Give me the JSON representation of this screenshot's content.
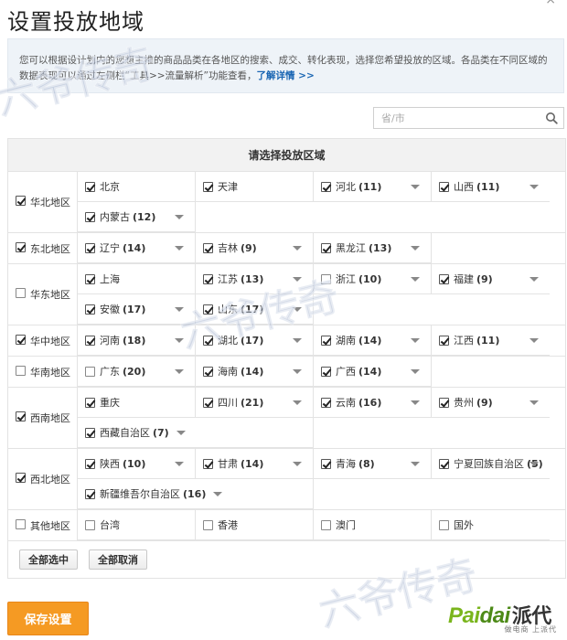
{
  "dialog": {
    "title": "设置投放地域",
    "close_label": "×"
  },
  "notice": {
    "text": "您可以根据设计划内的您想主推的商品品类在各地区的搜索、成交、转化表现，选择您希望投放的区域。各品类在不同区域的数据表现可以通过左侧栏“工具>>流量解析”功能查看，",
    "link": "了解详情 >>"
  },
  "search": {
    "placeholder": "省/市",
    "value": "",
    "icon": "search-icon"
  },
  "table": {
    "header": "请选择投放区域",
    "regions": [
      {
        "name": "华北地区",
        "checked": true,
        "provinces": [
          {
            "name": "北京",
            "count": "",
            "checked": true,
            "arrow": false
          },
          {
            "name": "天津",
            "count": "",
            "checked": true,
            "arrow": false
          },
          {
            "name": "河北",
            "count": "(11)",
            "checked": true,
            "arrow": true
          },
          {
            "name": "山西",
            "count": "(11)",
            "checked": true,
            "arrow": true
          },
          {
            "name": "内蒙古",
            "count": "(12)",
            "checked": true,
            "arrow": true
          }
        ]
      },
      {
        "name": "东北地区",
        "checked": true,
        "provinces": [
          {
            "name": "辽宁",
            "count": "(14)",
            "checked": true,
            "arrow": true
          },
          {
            "name": "吉林",
            "count": "(9)",
            "checked": true,
            "arrow": true
          },
          {
            "name": "黑龙江",
            "count": "(13)",
            "checked": true,
            "arrow": true
          }
        ]
      },
      {
        "name": "华东地区",
        "checked": false,
        "provinces": [
          {
            "name": "上海",
            "count": "",
            "checked": true,
            "arrow": false
          },
          {
            "name": "江苏",
            "count": "(13)",
            "checked": true,
            "arrow": true
          },
          {
            "name": "浙江",
            "count": "(10)",
            "checked": false,
            "arrow": true
          },
          {
            "name": "福建",
            "count": "(9)",
            "checked": true,
            "arrow": true
          },
          {
            "name": "安徽",
            "count": "(17)",
            "checked": true,
            "arrow": true
          },
          {
            "name": "山东",
            "count": "(17)",
            "checked": true,
            "arrow": true
          }
        ]
      },
      {
        "name": "华中地区",
        "checked": true,
        "provinces": [
          {
            "name": "河南",
            "count": "(18)",
            "checked": true,
            "arrow": true
          },
          {
            "name": "湖北",
            "count": "(17)",
            "checked": true,
            "arrow": true
          },
          {
            "name": "湖南",
            "count": "(14)",
            "checked": true,
            "arrow": true
          },
          {
            "name": "江西",
            "count": "(11)",
            "checked": true,
            "arrow": true
          }
        ]
      },
      {
        "name": "华南地区",
        "checked": false,
        "provinces": [
          {
            "name": "广东",
            "count": "(20)",
            "checked": false,
            "arrow": true
          },
          {
            "name": "海南",
            "count": "(14)",
            "checked": true,
            "arrow": true
          },
          {
            "name": "广西",
            "count": "(14)",
            "checked": true,
            "arrow": true
          }
        ]
      },
      {
        "name": "西南地区",
        "checked": true,
        "provinces": [
          {
            "name": "重庆",
            "count": "",
            "checked": true,
            "arrow": false
          },
          {
            "name": "四川",
            "count": "(21)",
            "checked": true,
            "arrow": true
          },
          {
            "name": "云南",
            "count": "(16)",
            "checked": true,
            "arrow": true
          },
          {
            "name": "贵州",
            "count": "(9)",
            "checked": true,
            "arrow": true
          },
          {
            "name": "西藏自治区",
            "count": "(7)",
            "checked": true,
            "arrow": true
          }
        ]
      },
      {
        "name": "西北地区",
        "checked": true,
        "provinces": [
          {
            "name": "陕西",
            "count": "(10)",
            "checked": true,
            "arrow": true
          },
          {
            "name": "甘肃",
            "count": "(14)",
            "checked": true,
            "arrow": true
          },
          {
            "name": "青海",
            "count": "(8)",
            "checked": true,
            "arrow": true
          },
          {
            "name": "宁夏回族自治区",
            "count": "(5)",
            "checked": true,
            "arrow": true
          },
          {
            "name": "新疆维吾尔自治区",
            "count": "(16)",
            "checked": true,
            "arrow": true
          }
        ]
      },
      {
        "name": "其他地区",
        "checked": false,
        "provinces": [
          {
            "name": "台湾",
            "count": "",
            "checked": false,
            "arrow": false
          },
          {
            "name": "香港",
            "count": "",
            "checked": false,
            "arrow": false
          },
          {
            "name": "澳门",
            "count": "",
            "checked": false,
            "arrow": false
          },
          {
            "name": "国外",
            "count": "",
            "checked": false,
            "arrow": false
          }
        ]
      }
    ],
    "select_all_label": "全部选中",
    "deselect_all_label": "全部取消"
  },
  "footer": {
    "save_label": "保存设置"
  },
  "logo": {
    "brand_a": "Pai",
    "brand_b": "dai",
    "brand_cn": "派代",
    "tagline": "做电商 上派代"
  },
  "watermark": {
    "text": "六爷传奇"
  },
  "colors": {
    "accent": "#f59a23",
    "link": "#1a66b3",
    "notice_bg": "#eef3f8",
    "header_bg": "#f2f2f2",
    "logo_green": "#7ab51d"
  }
}
